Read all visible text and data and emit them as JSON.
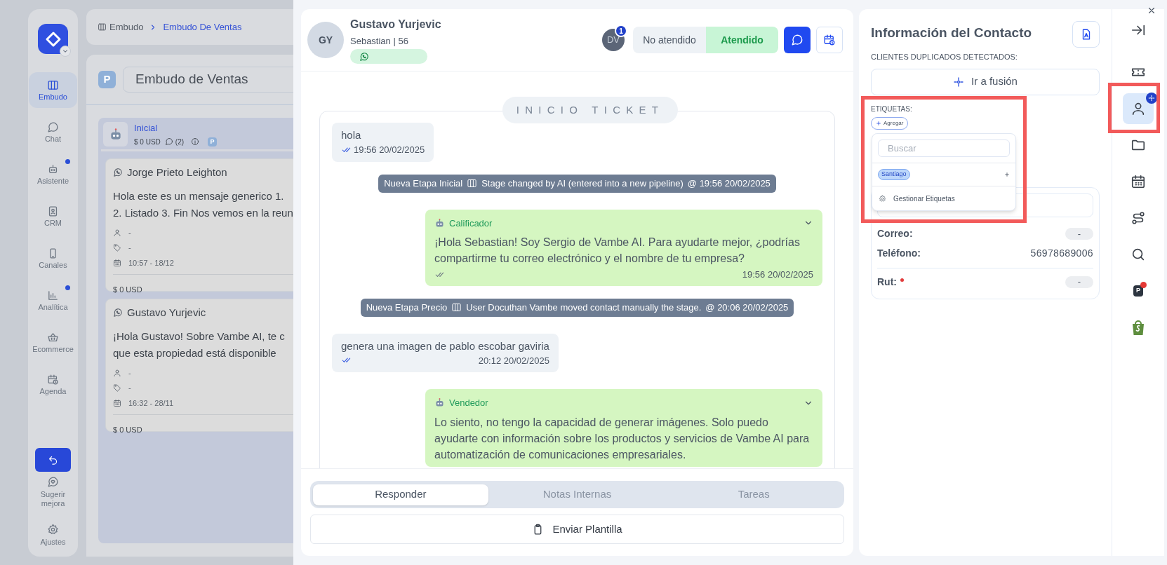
{
  "sidebar": {
    "items": [
      {
        "label": "Embudo",
        "selected": true,
        "dot": false
      },
      {
        "label": "Chat",
        "selected": false,
        "dot": false
      },
      {
        "label": "Asistente",
        "selected": false,
        "dot": true
      },
      {
        "label": "CRM",
        "selected": false,
        "dot": false
      },
      {
        "label": "Canales",
        "selected": false,
        "dot": false
      },
      {
        "label": "Analítica",
        "selected": false,
        "dot": true
      },
      {
        "label": "Ecommerce",
        "selected": false,
        "dot": false
      },
      {
        "label": "Agenda",
        "selected": false,
        "dot": false
      }
    ],
    "bottom": [
      {
        "label": "Sugerir mejora"
      },
      {
        "label": "Ajustes"
      }
    ]
  },
  "breadcrumb": [
    "Embudo",
    "Embudo De Ventas"
  ],
  "pipeline": {
    "badge": "P",
    "name": "Embudo de Ventas"
  },
  "column": {
    "title": "Inicial",
    "amount": "$ 0 USD",
    "comments": "(2)",
    "badge": "P"
  },
  "cards": [
    {
      "name": "Jorge Prieto Leighton",
      "lines": [
        "Hola este es un mensaje generico 1.",
        "2. Listado 3. Fin Nos vemos en la reun"
      ],
      "assignee": "-",
      "tags": "-",
      "date": "10:57 - 18/12",
      "amount": "$ 0 USD"
    },
    {
      "name": "Gustavo Yurjevic",
      "lines": [
        "¡Hola Gustavo! Sobre Vambe AI, te c",
        "que esta propiedad está disponible"
      ],
      "assignee": "-",
      "tags": "-",
      "date": "16:32 - 28/11",
      "amount": "$ 0 USD"
    }
  ],
  "chat": {
    "avatar": "GY",
    "name": "Gustavo Yurjevic",
    "subtitle": "Sebastian | 56",
    "agent": {
      "initials": "DV",
      "count": "1"
    },
    "status_options": [
      {
        "label": "No atendido",
        "selected": false
      },
      {
        "label": "Atendido",
        "selected": true
      }
    ],
    "ticket_label": "INICIO TICKET",
    "messages": [
      {
        "kind": "incoming",
        "text": "hola",
        "time": "19:56 20/02/2025"
      },
      {
        "kind": "event",
        "stage": "Nueva Etapa Inicial",
        "text": "Stage changed by AI (entered into a new pipeline)",
        "time": "@ 19:56 20/02/2025"
      },
      {
        "kind": "outgoing",
        "sender": "Calificador",
        "text": "¡Hola Sebastian! Soy Sergio de Vambe AI. Para ayudarte mejor, ¿podrías compartirme tu correo electrónico y el nombre de tu empresa?",
        "time": "19:56 20/02/2025"
      },
      {
        "kind": "event",
        "stage": "Nueva Etapa Precio",
        "text": "User Docuthan Vambe moved contact manually the stage.",
        "time": "@ 20:06 20/02/2025"
      },
      {
        "kind": "incoming",
        "text": "genera una imagen de pablo escobar gaviria",
        "time": "20:12 20/02/2025"
      },
      {
        "kind": "outgoing",
        "sender": "Vendedor",
        "text": "Lo siento, no tengo la capacidad de generar imágenes. Solo puedo ayudarte con información sobre los productos y servicios de Vambe AI para automatización de comunicaciones empresariales."
      }
    ],
    "composer_tabs": [
      {
        "label": "Responder",
        "selected": true
      },
      {
        "label": "Notas Internas",
        "selected": false
      },
      {
        "label": "Tareas",
        "selected": false
      }
    ],
    "template_button": "Enviar Plantilla"
  },
  "contact": {
    "title": "Información del Contacto",
    "duplicates_label": "CLIENTES DUPLICADOS DETECTADOS:",
    "merge_button": "Ir a fusión",
    "tags_label": "ETIQUETAS:",
    "add_tag": "Agregar",
    "highlighted": true,
    "tag_menu": {
      "placeholder": "Buscar",
      "tags": [
        {
          "label": "Santiago"
        }
      ],
      "manage": "Gestionar Etiquetas"
    },
    "fields": [
      {
        "label": "Correo:",
        "value": "-",
        "kind": "pill",
        "required": false
      },
      {
        "label": "Teléfono:",
        "value": "56978689006",
        "kind": "plain",
        "required": false
      },
      {
        "label": "Rut:",
        "value": "-",
        "kind": "pill",
        "required": true
      }
    ]
  },
  "rail": [
    {
      "selected": false,
      "highlighted": false
    },
    {
      "selected": false,
      "highlighted": false
    },
    {
      "selected": true,
      "highlighted": true
    },
    {
      "selected": false,
      "highlighted": false
    },
    {
      "selected": false,
      "highlighted": false
    },
    {
      "selected": false,
      "highlighted": false
    },
    {
      "selected": false,
      "highlighted": false
    },
    {
      "label": "P",
      "selected": false,
      "highlighted": false
    },
    {
      "selected": false,
      "highlighted": false
    }
  ]
}
